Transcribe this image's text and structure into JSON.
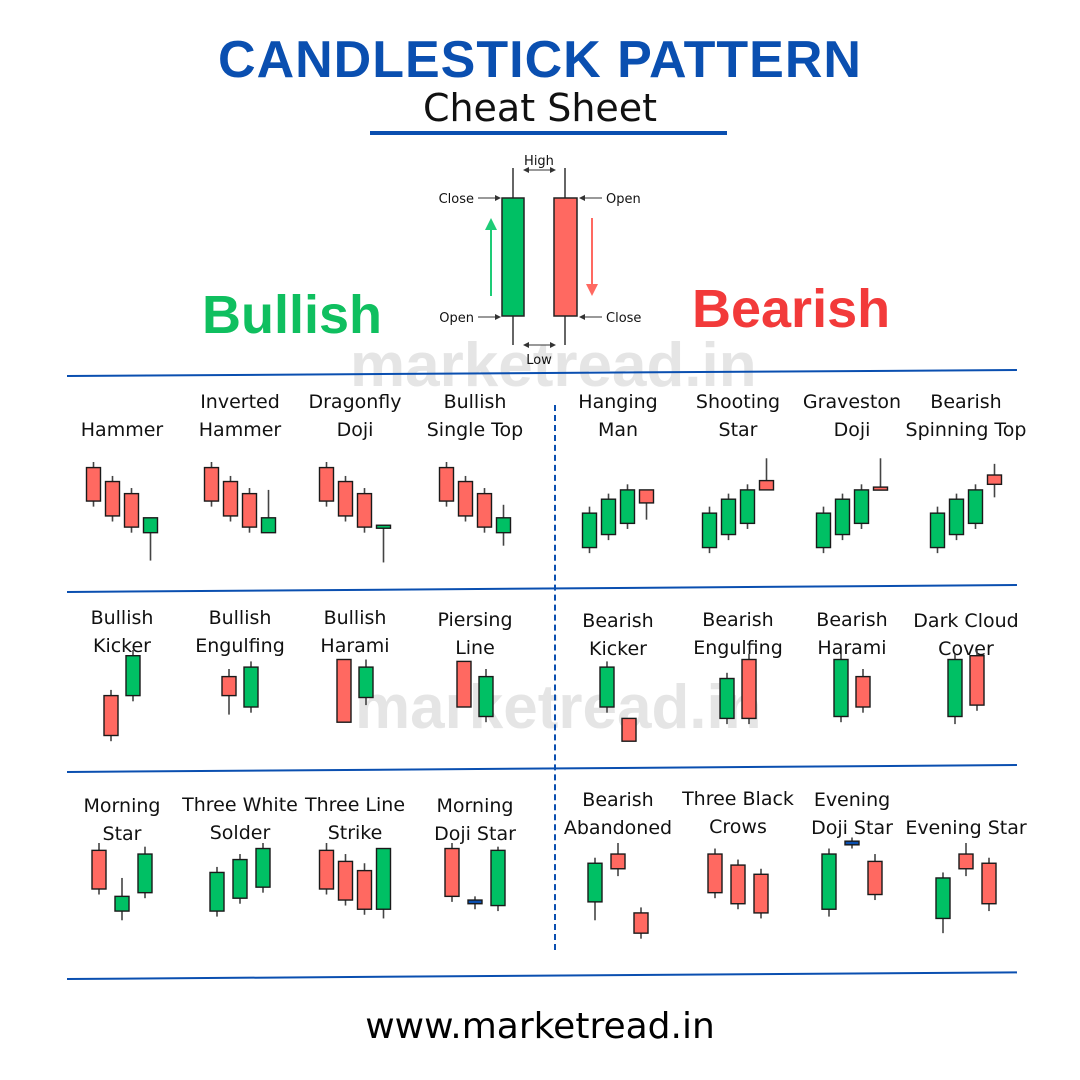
{
  "header": {
    "title": "CANDLESTICK PATTERN",
    "subtitle": "Cheat Sheet"
  },
  "sections": {
    "bullish": "Bullish",
    "bearish": "Bearish"
  },
  "watermark": "marketread.in",
  "footer": "www.marketread.in",
  "colors": {
    "bull": "#00c064",
    "bear": "#ff6961",
    "doji": "#0a4fb0",
    "accent": "#0a4fb0",
    "bullish_text": "#0fbf5f",
    "bearish_text": "#f23a3a"
  },
  "legend": {
    "high": "High",
    "low": "Low",
    "bull_close": "Close",
    "bull_open": "Open",
    "bear_open": "Open",
    "bear_close": "Close"
  },
  "patterns": [
    {
      "name": "Hammer",
      "row": 0,
      "col": 0,
      "lines": [
        "",
        "Hammer"
      ],
      "candles": [
        [
          "bear",
          100,
          94,
          58,
          52
        ],
        [
          "bear",
          85,
          79,
          42,
          36
        ],
        [
          "bear",
          72,
          66,
          30,
          24
        ],
        [
          "bull",
          40,
          40,
          24,
          -6
        ]
      ]
    },
    {
      "name": "Inverted Hammer",
      "row": 0,
      "col": 1,
      "lines": [
        "Inverted",
        "Hammer"
      ],
      "candles": [
        [
          "bear",
          100,
          94,
          58,
          52
        ],
        [
          "bear",
          85,
          79,
          42,
          36
        ],
        [
          "bear",
          72,
          66,
          30,
          24
        ],
        [
          "bull",
          70,
          40,
          24,
          24
        ]
      ]
    },
    {
      "name": "Dragonfly Doji",
      "row": 0,
      "col": 2,
      "lines": [
        "Dragonfly",
        "Doji"
      ],
      "candles": [
        [
          "bear",
          100,
          94,
          58,
          52
        ],
        [
          "bear",
          85,
          79,
          42,
          36
        ],
        [
          "bear",
          72,
          66,
          30,
          24
        ],
        [
          "bull",
          32,
          32,
          29,
          -8
        ]
      ]
    },
    {
      "name": "Bullish Single Top",
      "row": 0,
      "col": 3,
      "lines": [
        "Bullish",
        "Single Top"
      ],
      "candles": [
        [
          "bear",
          100,
          94,
          58,
          52
        ],
        [
          "bear",
          85,
          79,
          42,
          36
        ],
        [
          "bear",
          72,
          66,
          30,
          24
        ],
        [
          "bull",
          54,
          40,
          24,
          10
        ]
      ]
    },
    {
      "name": "Hanging Man",
      "row": 0,
      "col": 4,
      "lines": [
        "Hanging",
        "Man"
      ],
      "candles": [
        [
          "bull",
          52,
          45,
          8,
          2
        ],
        [
          "bull",
          66,
          60,
          22,
          16
        ],
        [
          "bull",
          76,
          70,
          34,
          28
        ],
        [
          "bear",
          70,
          70,
          56,
          38
        ]
      ]
    },
    {
      "name": "Shooting Star",
      "row": 0,
      "col": 5,
      "lines": [
        "Shooting",
        "Star"
      ],
      "candles": [
        [
          "bull",
          52,
          45,
          8,
          2
        ],
        [
          "bull",
          66,
          60,
          22,
          16
        ],
        [
          "bull",
          76,
          70,
          34,
          28
        ],
        [
          "bear",
          104,
          80,
          70,
          70
        ]
      ]
    },
    {
      "name": "Graveston Doji",
      "row": 0,
      "col": 6,
      "lines": [
        "Graveston",
        "Doji"
      ],
      "candles": [
        [
          "bull",
          52,
          45,
          8,
          2
        ],
        [
          "bull",
          66,
          60,
          22,
          16
        ],
        [
          "bull",
          76,
          70,
          34,
          28
        ],
        [
          "bear",
          104,
          73,
          70,
          70
        ]
      ]
    },
    {
      "name": "Bearish Spinning Top",
      "row": 0,
      "col": 7,
      "lines": [
        "Bearish",
        "Spinning Top"
      ],
      "candles": [
        [
          "bull",
          52,
          45,
          8,
          2
        ],
        [
          "bull",
          66,
          60,
          22,
          16
        ],
        [
          "bull",
          76,
          70,
          34,
          28
        ],
        [
          "bear",
          98,
          86,
          76,
          62
        ]
      ]
    },
    {
      "name": "Bullish Kicker",
      "row": 1,
      "col": 0,
      "lines": [
        "Bullish",
        "Kicker"
      ],
      "candles": [
        [
          "bear",
          58,
          52,
          10,
          4
        ],
        [
          "bull",
          100,
          94,
          52,
          46
        ]
      ]
    },
    {
      "name": "Bullish Engulfing",
      "row": 1,
      "col": 1,
      "lines": [
        "Bullish",
        "Engulfing"
      ],
      "candles": [
        [
          "bear",
          80,
          72,
          52,
          32
        ],
        [
          "bull",
          88,
          82,
          40,
          34
        ]
      ]
    },
    {
      "name": "Bullish Harami",
      "row": 1,
      "col": 2,
      "lines": [
        "Bullish",
        "Harami"
      ],
      "candles": [
        [
          "bear",
          90,
          90,
          24,
          24
        ],
        [
          "bull",
          90,
          82,
          50,
          42
        ]
      ]
    },
    {
      "name": "Piersing Line",
      "row": 1,
      "col": 3,
      "lines": [
        "Piersing",
        "Line"
      ],
      "candles": [
        [
          "bear",
          88,
          88,
          40,
          40
        ],
        [
          "bull",
          80,
          72,
          30,
          24
        ]
      ]
    },
    {
      "name": "Bearish Kicker",
      "row": 1,
      "col": 4,
      "lines": [
        "Bearish",
        "Kicker"
      ],
      "candles": [
        [
          "bull",
          88,
          82,
          40,
          34
        ],
        [
          "bear",
          28,
          28,
          4,
          4
        ]
      ]
    },
    {
      "name": "Bearish Engulfing",
      "row": 1,
      "col": 5,
      "lines": [
        "Bearish",
        "Engulfing"
      ],
      "candles": [
        [
          "bull",
          76,
          70,
          28,
          22
        ],
        [
          "bear",
          96,
          90,
          28,
          22
        ]
      ]
    },
    {
      "name": "Bearish Harami",
      "row": 1,
      "col": 6,
      "lines": [
        "Bearish",
        "Harami"
      ],
      "candles": [
        [
          "bull",
          96,
          90,
          30,
          24
        ],
        [
          "bear",
          80,
          72,
          40,
          34
        ]
      ]
    },
    {
      "name": "Dark Cloud Cover",
      "row": 1,
      "col": 7,
      "lines": [
        "Dark Cloud",
        "Cover"
      ],
      "candles": [
        [
          "bull",
          96,
          90,
          30,
          22
        ],
        [
          "bear",
          100,
          94,
          42,
          36
        ]
      ]
    },
    {
      "name": "Morning Star",
      "row": 2,
      "col": 0,
      "lines": [
        "Morning",
        "Star"
      ],
      "candles": [
        [
          "bear",
          100,
          92,
          50,
          44
        ],
        [
          "bull",
          62,
          42,
          26,
          16
        ],
        [
          "bull",
          96,
          88,
          46,
          40
        ]
      ]
    },
    {
      "name": "Three White Solder",
      "row": 2,
      "col": 1,
      "lines": [
        "Three White",
        "Solder"
      ],
      "candles": [
        [
          "bull",
          74,
          68,
          26,
          20
        ],
        [
          "bull",
          88,
          82,
          40,
          34
        ],
        [
          "bull",
          100,
          94,
          52,
          46
        ]
      ]
    },
    {
      "name": "Three Line Strike",
      "row": 2,
      "col": 2,
      "lines": [
        "Three Line",
        "Strike"
      ],
      "candles": [
        [
          "bear",
          100,
          92,
          50,
          44
        ],
        [
          "bear",
          88,
          80,
          38,
          32
        ],
        [
          "bear",
          78,
          70,
          28,
          22
        ],
        [
          "bull",
          94,
          94,
          28,
          18
        ]
      ]
    },
    {
      "name": "Morning Doji Star",
      "row": 2,
      "col": 3,
      "lines": [
        "Morning",
        "Doji Star"
      ],
      "candles": [
        [
          "bear",
          100,
          94,
          42,
          36
        ],
        [
          "doji",
          42,
          38,
          34,
          28
        ],
        [
          "bull",
          96,
          92,
          32,
          26
        ]
      ]
    },
    {
      "name": "Bearish Abandoned",
      "row": 2,
      "col": 4,
      "lines": [
        "Bearish",
        "Abandoned"
      ],
      "candles": [
        [
          "bull",
          84,
          78,
          36,
          16
        ],
        [
          "bear",
          100,
          88,
          72,
          64
        ],
        [
          "bear",
          30,
          24,
          2,
          -4
        ]
      ]
    },
    {
      "name": "Three Black Crows",
      "row": 2,
      "col": 5,
      "lines": [
        "Three Black",
        "Crows"
      ],
      "candles": [
        [
          "bear",
          94,
          88,
          46,
          40
        ],
        [
          "bear",
          82,
          76,
          34,
          28
        ],
        [
          "bear",
          72,
          66,
          24,
          18
        ]
      ]
    },
    {
      "name": "Evening Doji Star",
      "row": 2,
      "col": 6,
      "lines": [
        "Evening",
        "Doji Star"
      ],
      "candles": [
        [
          "bull",
          94,
          88,
          28,
          20
        ],
        [
          "doji",
          106,
          102,
          98,
          94
        ],
        [
          "bear",
          88,
          80,
          44,
          38
        ]
      ]
    },
    {
      "name": "Evening Star",
      "row": 2,
      "col": 7,
      "lines": [
        "",
        "Evening Star"
      ],
      "candles": [
        [
          "bull",
          68,
          62,
          18,
          2
        ],
        [
          "bear",
          100,
          88,
          72,
          64
        ],
        [
          "bear",
          84,
          78,
          34,
          26
        ]
      ]
    }
  ]
}
